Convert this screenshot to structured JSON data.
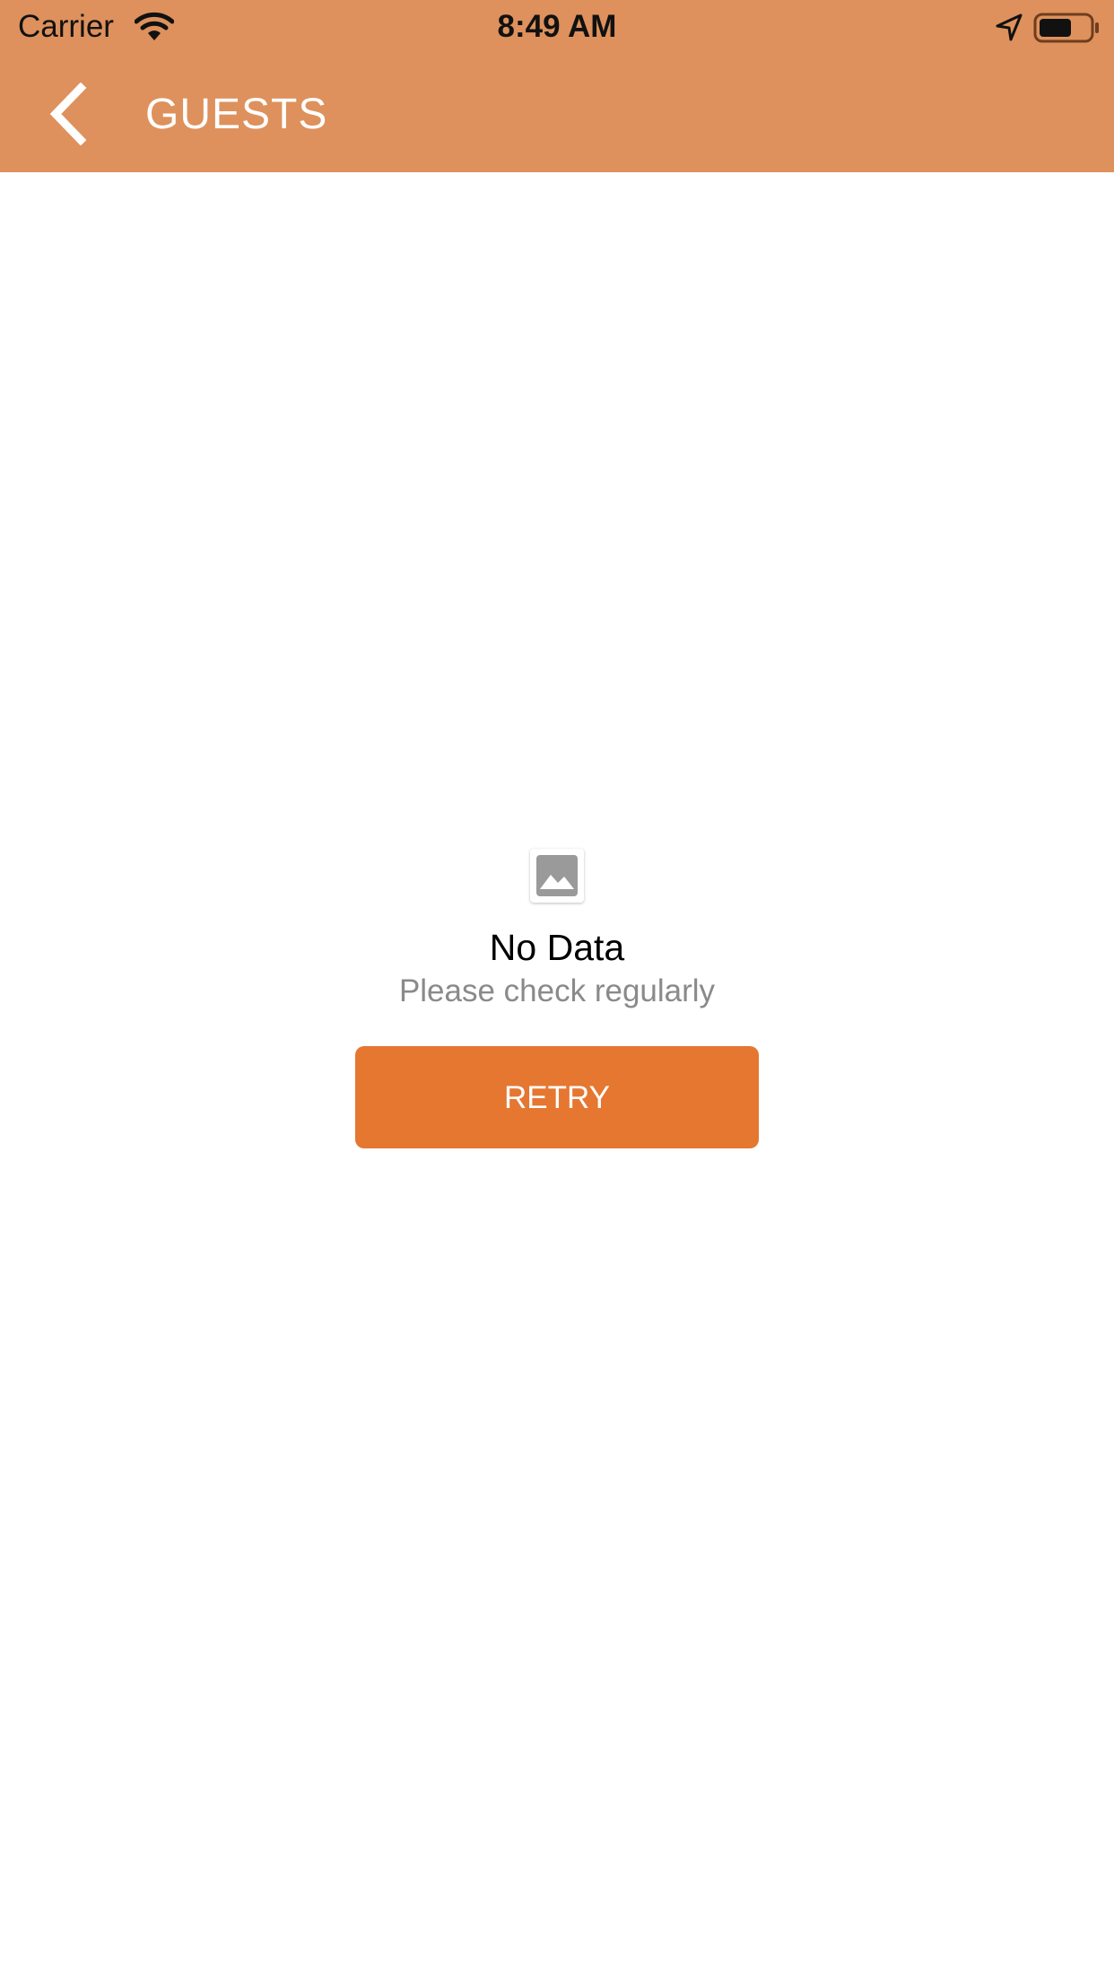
{
  "colors": {
    "header": "#DE915C",
    "accent": "#E57731",
    "background": "#FFFFFF",
    "subtitle": "#8A8A8A"
  },
  "status_bar": {
    "carrier": "Carrier",
    "time": "8:49 AM",
    "icons": [
      "wifi-icon",
      "location-arrow-icon",
      "battery-icon"
    ],
    "battery_level": 0.65
  },
  "nav": {
    "back_icon": "chevron-left-icon",
    "title": "GUESTS"
  },
  "empty_state": {
    "icon": "image-placeholder-icon",
    "title": "No Data",
    "subtitle": "Please check regularly",
    "retry_label": "RETRY"
  }
}
